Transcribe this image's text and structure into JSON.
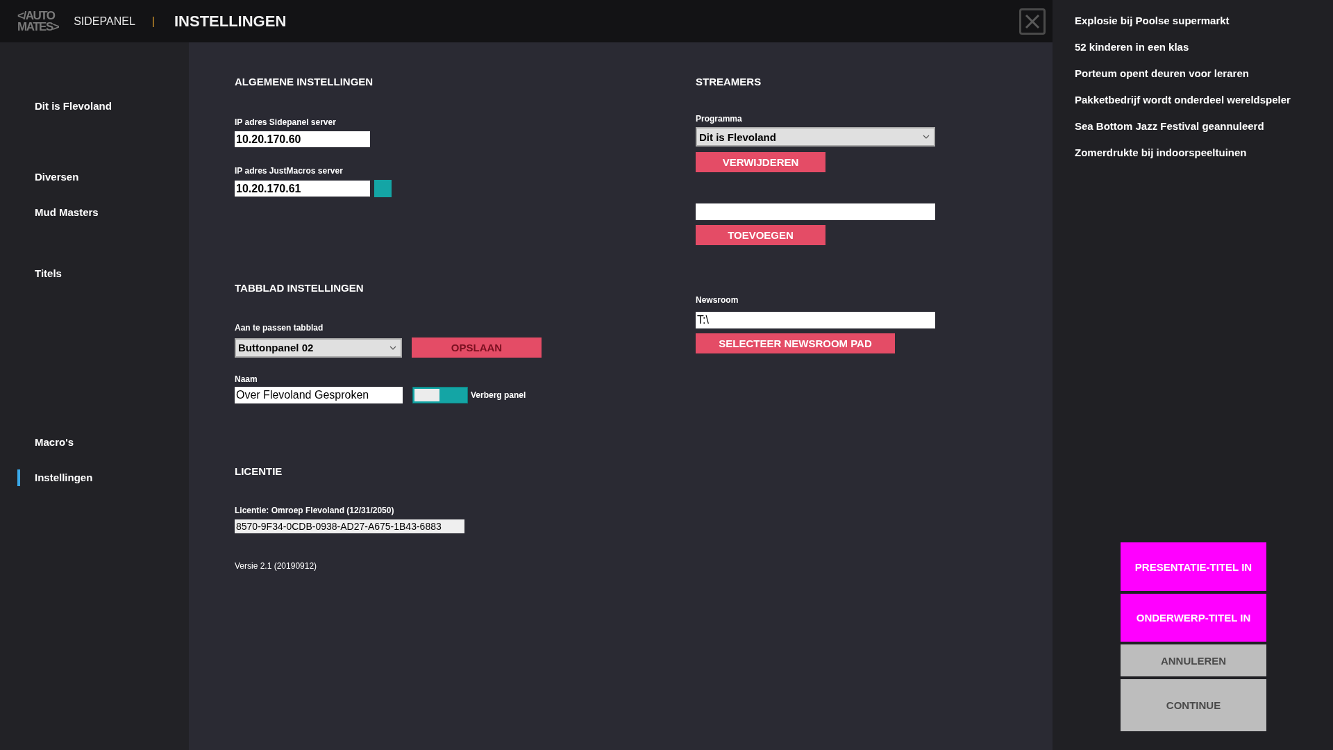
{
  "header": {
    "logo": [
      "</AUTO",
      "MATES>"
    ],
    "app": "SIDEPANEL",
    "separator": "|",
    "title": "INSTELLINGEN"
  },
  "sidebar": {
    "items": [
      {
        "label": "Dit is Flevoland",
        "selected": false
      },
      {
        "label": "Diversen",
        "selected": false
      },
      {
        "label": "Mud Masters",
        "selected": false
      },
      {
        "label": "Titels",
        "selected": false
      },
      {
        "label": "Macro's",
        "selected": false
      },
      {
        "label": "Instellingen",
        "selected": true
      }
    ]
  },
  "general": {
    "heading": "ALGEMENE INSTELLINGEN",
    "sidepanel_label": "IP adres Sidepanel server",
    "sidepanel_ip": "10.20.170.60",
    "macros_label": "IP adres JustMacros server",
    "macros_ip": "10.20.170.61"
  },
  "tab_settings": {
    "heading": "TABBLAD INSTELLINGEN",
    "tab_label": "Aan te passen tabblad",
    "tab_value": "Buttonpanel 02",
    "save": "OPSLAAN",
    "name_label": "Naam",
    "name_value": "Over Flevoland Gesproken",
    "hide_on": true,
    "hide_label": "Verberg panel"
  },
  "license": {
    "heading": "LICENTIE",
    "label": "Licentie: Omroep Flevoland (12/31/2050)",
    "key": "8570-9F34-0CDB-0938-AD27-A675-1B43-6883",
    "version": "Versie 2.1 (20190912)"
  },
  "streamers": {
    "heading": "STREAMERS",
    "program_label": "Programma",
    "program_value": "Dit is Flevoland",
    "remove": "VERWIJDEREN",
    "add": "TOEVOEGEN",
    "newsroom_label": "Newsroom",
    "newsroom_value": "T:\\",
    "select_path": "SELECTEER NEWSROOM PAD"
  },
  "news": [
    "Explosie bij Poolse supermarkt",
    "52 kinderen in een klas",
    "Porteum opent deuren voor leraren",
    "Pakketbedrijf wordt onderdeel wereldspeler",
    "Sea Bottom Jazz Festival geannuleerd",
    "Zomerdrukte bij indoorspeeltuinen"
  ],
  "actions": [
    {
      "label": "PRESENTATIE-TITEL IN",
      "kind": "accent"
    },
    {
      "label": "ONDERWERP-TITEL IN",
      "kind": "accent"
    },
    {
      "label": "ANNULEREN",
      "kind": "neutral"
    },
    {
      "label": "CONTINUE",
      "kind": "neutral"
    }
  ]
}
